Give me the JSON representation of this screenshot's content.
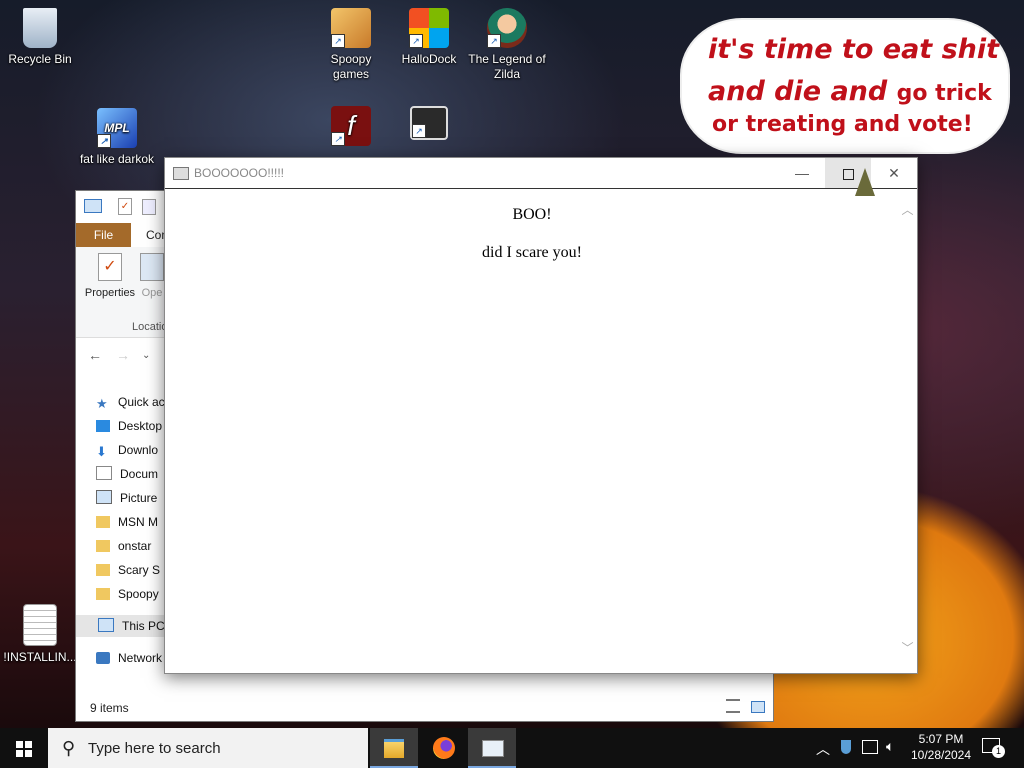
{
  "desktop": {
    "icons": [
      {
        "label": "Recycle Bin"
      },
      {
        "label": "Spoopy games"
      },
      {
        "label": "HalloDock"
      },
      {
        "label": "The Legend of Zilda"
      },
      {
        "label": "fat like darkok"
      },
      {
        "label": "!INSTALLIN..."
      }
    ],
    "wallpaper_text": {
      "line1": "it's time to eat shit",
      "line2a": "and die and",
      "line2b": "go trick",
      "line3": "or treating and vote!"
    }
  },
  "explorer": {
    "tabs": {
      "file": "File",
      "con": "Con"
    },
    "ribbon": {
      "properties": "Properties",
      "open": "Ope",
      "group": "Locatio"
    },
    "nav_items": [
      {
        "label": "Quick ac",
        "icon": "star-icon"
      },
      {
        "label": "Desktop",
        "icon": "desktop-icon"
      },
      {
        "label": "Downlo",
        "icon": "download-icon"
      },
      {
        "label": "Docum",
        "icon": "document-icon"
      },
      {
        "label": "Picture",
        "icon": "picture-icon"
      },
      {
        "label": "MSN M",
        "icon": "folder-icon"
      },
      {
        "label": "onstar",
        "icon": "folder-icon"
      },
      {
        "label": "Scary S",
        "icon": "folder-icon"
      },
      {
        "label": "Spoopy",
        "icon": "folder-icon"
      },
      {
        "label": "This PC",
        "icon": "computer-icon"
      },
      {
        "label": "Network",
        "icon": "network-icon"
      }
    ],
    "status": "9 items"
  },
  "dialog": {
    "title": "BOOOOOOO!!!!!",
    "heading": "BOO!",
    "message": "did I scare you!"
  },
  "taskbar": {
    "search_placeholder": "Type here to search",
    "time": "5:07 PM",
    "date": "10/28/2024",
    "notification_count": "1"
  },
  "colors": {
    "accent": "#a46a2a",
    "bubble_text": "#c0101a",
    "taskbar": "#101010"
  }
}
